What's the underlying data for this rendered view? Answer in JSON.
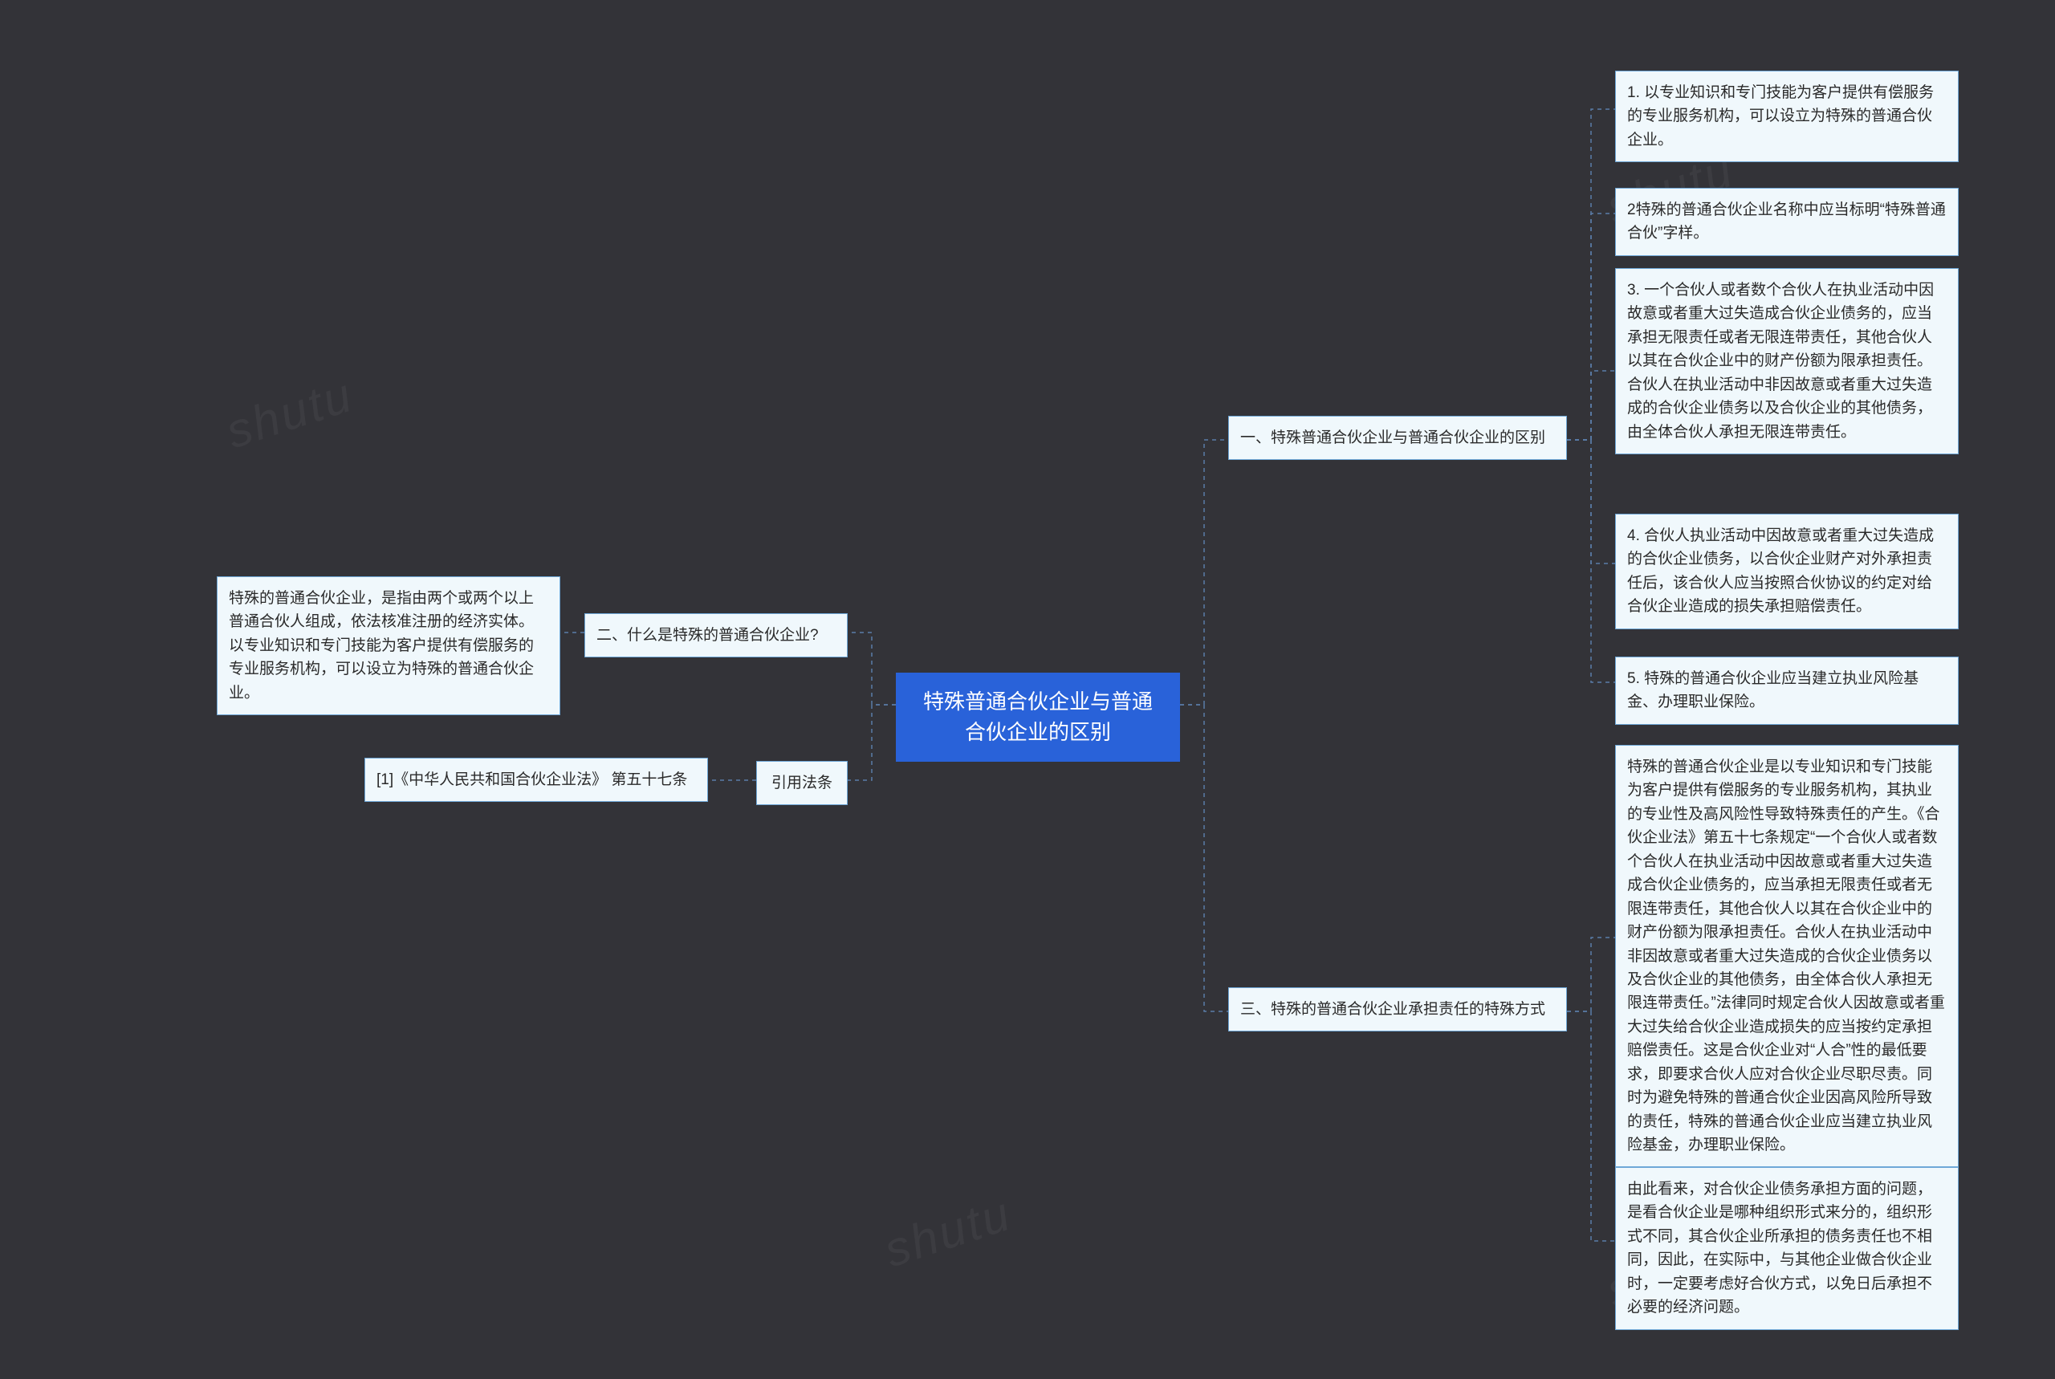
{
  "root": {
    "title_line1": "特殊普通合伙企业与普通",
    "title_line2": "合伙企业的区别"
  },
  "left": {
    "branch2": {
      "label": "二、什么是特殊的普通合伙企业?",
      "leaf": "特殊的普通合伙企业，是指由两个或两个以上普通合伙人组成，依法核准注册的经济实体。以专业知识和专门技能为客户提供有偿服务的专业服务机构，可以设立为特殊的普通合伙企业。"
    },
    "branch_ref": {
      "label": "引用法条",
      "leaf": "[1]《中华人民共和国合伙企业法》 第五十七条"
    }
  },
  "right": {
    "branch1": {
      "label": "一、特殊普通合伙企业与普通合伙企业的区别",
      "leaves": [
        "1. 以专业知识和专门技能为客户提供有偿服务的专业服务机构，可以设立为特殊的普通合伙企业。",
        "2特殊的普通合伙企业名称中应当标明“特殊普通合伙”字样。",
        "3. 一个合伙人或者数个合伙人在执业活动中因故意或者重大过失造成合伙企业债务的，应当承担无限责任或者无限连带责任，其他合伙人以其在合伙企业中的财产份额为限承担责任。合伙人在执业活动中非因故意或者重大过失造成的合伙企业债务以及合伙企业的其他债务，由全体合伙人承担无限连带责任。",
        "4. 合伙人执业活动中因故意或者重大过失造成的合伙企业债务，以合伙企业财产对外承担责任后，该合伙人应当按照合伙协议的约定对给合伙企业造成的损失承担赔偿责任。",
        "5. 特殊的普通合伙企业应当建立执业风险基金、办理职业保险。"
      ]
    },
    "branch3": {
      "label": "三、特殊的普通合伙企业承担责任的特殊方式",
      "leaves": [
        "特殊的普通合伙企业是以专业知识和专门技能为客户提供有偿服务的专业服务机构，其执业的专业性及高风险性导致特殊责任的产生。《合伙企业法》第五十七条规定“一个合伙人或者数个合伙人在执业活动中因故意或者重大过失造成合伙企业债务的，应当承担无限责任或者无限连带责任，其他合伙人以其在合伙企业中的财产份额为限承担责任。合伙人在执业活动中非因故意或者重大过失造成的合伙企业债务以及合伙企业的其他债务，由全体合伙人承担无限连带责任。”法律同时规定合伙人因故意或者重大过失给合伙企业造成损失的应当按约定承担赔偿责任。这是合伙企业对“人合”性的最低要求，即要求合伙人应对合伙企业尽职尽责。同时为避免特殊的普通合伙企业因高风险所导致的责任，特殊的普通合伙企业应当建立执业风险基金，办理职业保险。",
        "由此看来，对合伙企业债务承担方面的问题，是看合伙企业是哪种组织形式来分的，组织形式不同，其合伙企业所承担的债务责任也不相同，因此，在实际中，与其他企业做合伙企业时，一定要考虑好合伙方式，以免日后承担不必要的经济问题。"
      ]
    }
  }
}
